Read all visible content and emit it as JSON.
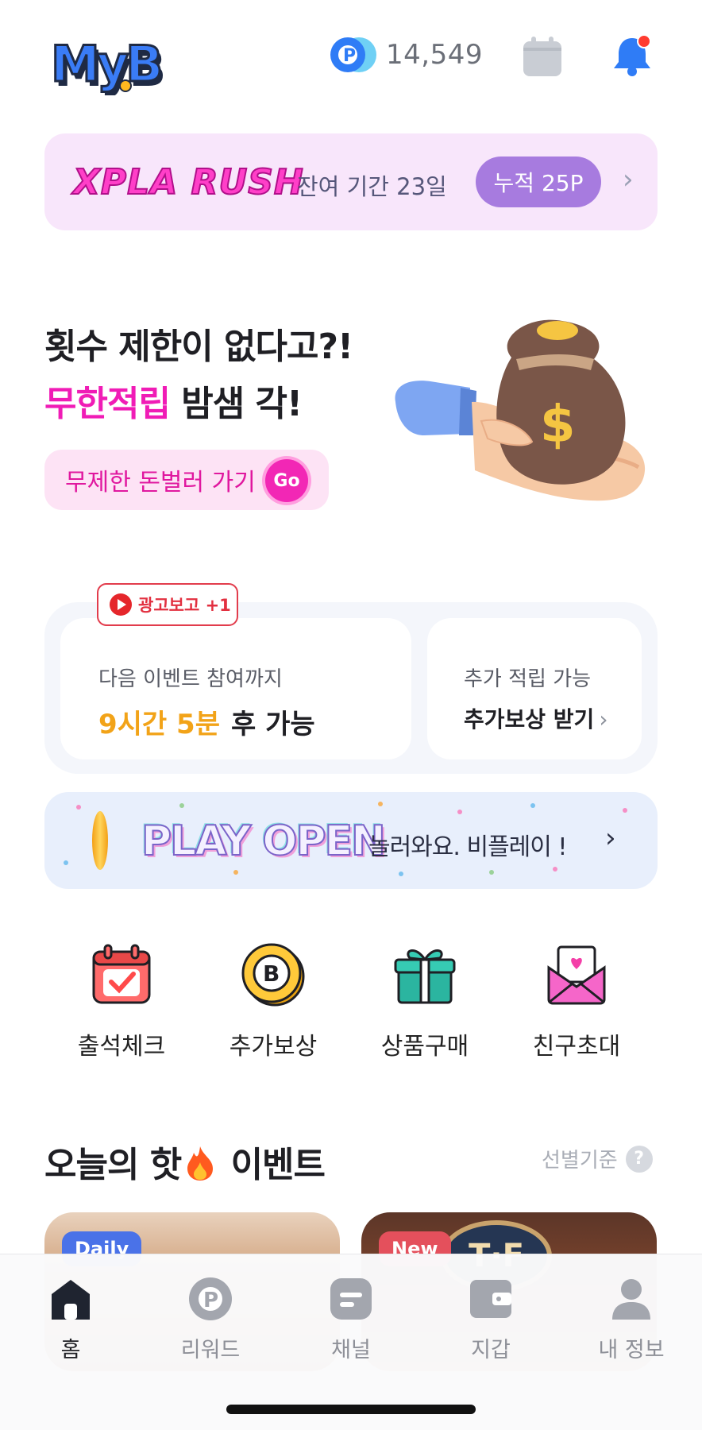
{
  "header": {
    "logo_text": "MyB",
    "points_value": "14,549",
    "point_icon": "p-coin-icon",
    "calendar_icon": "calendar-icon",
    "bell_icon": "bell-icon",
    "has_notification": true
  },
  "rush_banner": {
    "title": "XPLA RUSH",
    "remaining": "잔여 기간 23일",
    "accumulated": "누적 25P",
    "chevron": "›"
  },
  "hero": {
    "line1": "횟수 제한이 없다고?!",
    "line2_accent": "무한적립",
    "line2_rest": " 밤샘 각!",
    "button_label": "무제한 돈벌러 가기",
    "go_label": "Go",
    "image": "money-bag-hand-illustration"
  },
  "event_card": {
    "ad_tag": "광고보고 +1",
    "left_label": "다음 이벤트 참여까지",
    "left_time": "9시간 5분",
    "left_suffix": "후 가능",
    "right_label": "추가 적립 가능",
    "right_action": "추가보상 받기",
    "chevron": "›"
  },
  "play_banner": {
    "title": "PLAY OPEN",
    "subtitle": "놀러와요. 비플레이 !",
    "chevron": "›"
  },
  "quick_actions": [
    {
      "label": "출석체크",
      "icon": "calendar-check-icon"
    },
    {
      "label": "추가보상",
      "icon": "b-coin-icon"
    },
    {
      "label": "상품구매",
      "icon": "gift-icon"
    },
    {
      "label": "친구초대",
      "icon": "invite-envelope-icon"
    }
  ],
  "hot_events": {
    "title_before": "오늘의 핫",
    "title_after": " 이벤트",
    "criteria_label": "선별기준",
    "criteria_help": "?",
    "cards": [
      {
        "badge": "Daily"
      },
      {
        "badge": "New"
      }
    ]
  },
  "bottom_nav": {
    "items": [
      {
        "label": "홈",
        "icon": "home-icon",
        "active": true
      },
      {
        "label": "리워드",
        "icon": "reward-p-icon",
        "active": false
      },
      {
        "label": "채널",
        "icon": "channel-icon",
        "active": false
      },
      {
        "label": "지갑",
        "icon": "wallet-icon",
        "active": false
      },
      {
        "label": "내 정보",
        "icon": "profile-icon",
        "active": false
      }
    ]
  },
  "colors": {
    "accent_pink": "#f01cb6",
    "accent_purple": "#a77bdf",
    "time_orange": "#f2a318",
    "notification_red": "#ff3b30",
    "bell_blue": "#2f7cf6"
  }
}
